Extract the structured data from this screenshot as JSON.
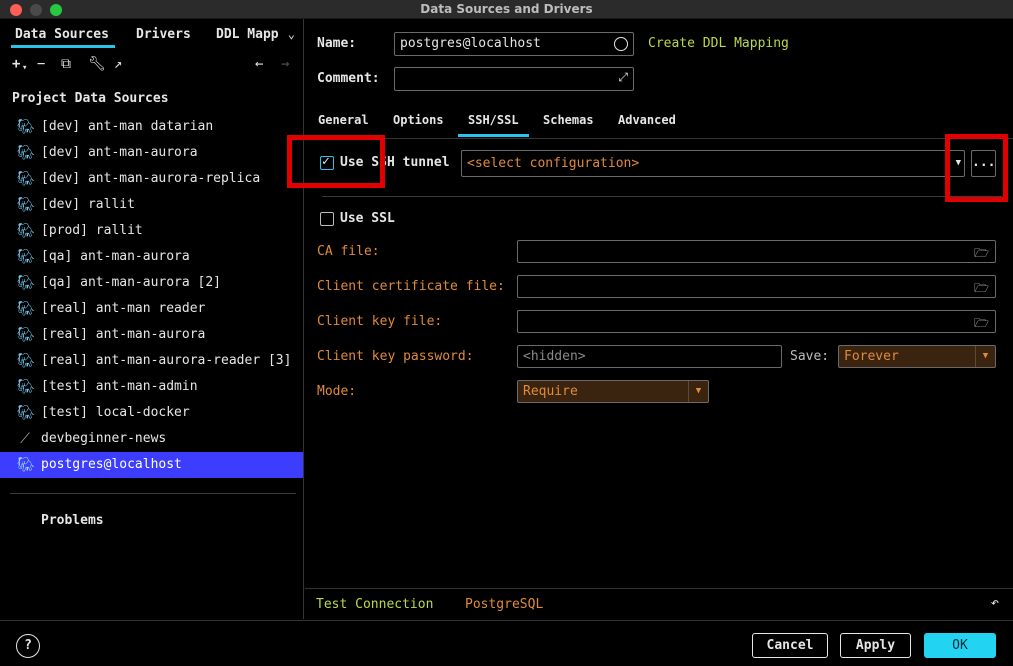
{
  "window": {
    "title": "Data Sources and Drivers"
  },
  "left": {
    "tabs": [
      "Data Sources",
      "Drivers",
      "DDL Mapp"
    ],
    "section_title": "Project Data Sources",
    "items": [
      "[dev] ant-man datarian",
      "[dev] ant-man-aurora",
      "[dev] ant-man-aurora-replica",
      "[dev] rallit",
      "[prod] rallit",
      "[qa] ant-man-aurora",
      "[qa] ant-man-aurora [2]",
      "[real] ant-man reader",
      "[real] ant-man-aurora",
      "[real] ant-man-aurora-reader [3]",
      "[test] ant-man-admin",
      "[test] local-docker",
      "devbeginner-news",
      "postgres@localhost"
    ],
    "problems": "Problems"
  },
  "form": {
    "name_label": "Name:",
    "name_value": "postgres@localhost",
    "comment_label": "Comment:",
    "comment_value": "",
    "create_ddl": "Create DDL Mapping"
  },
  "tabs": [
    "General",
    "Options",
    "SSH/SSL",
    "Schemas",
    "Advanced"
  ],
  "ssh": {
    "use_ssh_label": "Use SSH tunnel",
    "use_ssh_checked": true,
    "config_placeholder": "<select configuration>",
    "more_label": "..."
  },
  "ssl": {
    "use_ssl_label": "Use SSL",
    "use_ssl_checked": false,
    "ca_file_label": "CA file:",
    "client_cert_label": "Client certificate file:",
    "client_key_label": "Client key file:",
    "client_key_password_label": "Client key password:",
    "password_placeholder": "<hidden>",
    "save_label": "Save:",
    "save_value": "Forever",
    "mode_label": "Mode:",
    "mode_value": "Require"
  },
  "status": {
    "test_connection": "Test Connection",
    "driver": "PostgreSQL"
  },
  "footer": {
    "help": "?",
    "cancel": "Cancel",
    "apply": "Apply",
    "ok": "OK"
  },
  "colors": {
    "accent": "#2bc4e8",
    "selection": "#3d3dff",
    "highlight_box": "#e00000",
    "field_label": "#e08a3a",
    "link": "#b9d94a"
  }
}
